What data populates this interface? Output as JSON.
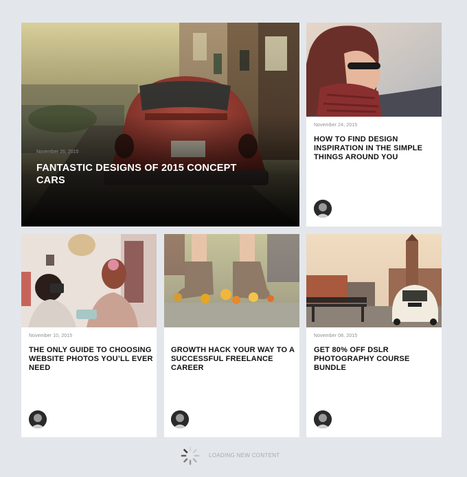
{
  "hero": {
    "date": "November 26, 2015",
    "title": "Fantastic designs of 2015 concept cars",
    "image_icon": "red-beetle-car-photo"
  },
  "cards": [
    {
      "date": "November 24, 2015",
      "title": "How to find design inspiration in the simple things around you",
      "image_icon": "woman-scarf-sunglasses-photo"
    },
    {
      "date": "November 10, 2015",
      "title": "The only guide to choosing website photos you’ll ever need",
      "image_icon": "girls-with-cameras-photo"
    },
    {
      "date": "",
      "title": "Growth hack your way to a successful freelance career",
      "image_icon": "boots-and-flowers-photo"
    },
    {
      "date": "November 08, 2015",
      "title": "Get 80% off DSLR photography course bundle",
      "image_icon": "vintage-car-town-square-photo"
    }
  ],
  "loading": {
    "text": "LOADING NEW CONTENT"
  },
  "colors": {
    "background": "#e3e7ec",
    "card": "#ffffff",
    "title": "#111111",
    "hero_overlay": "#0d0d0d",
    "beetle_red": "#b4463a"
  }
}
